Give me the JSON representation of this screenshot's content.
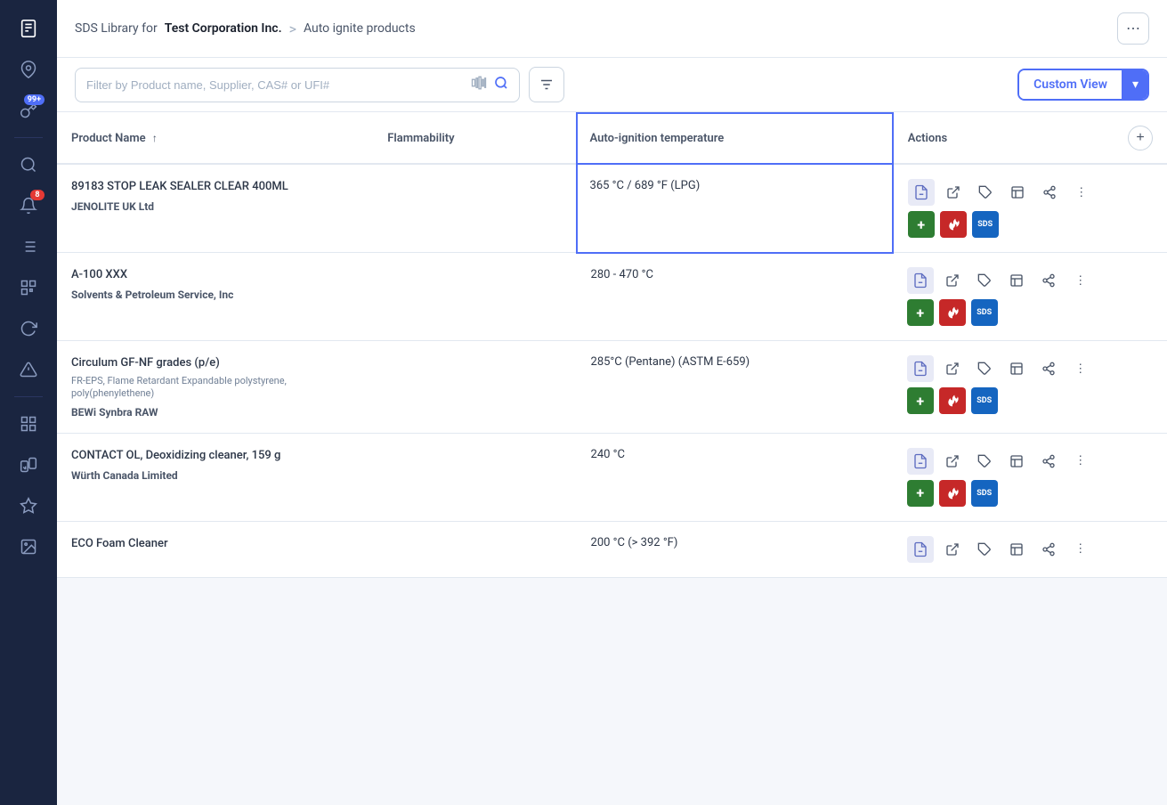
{
  "sidebar": {
    "items": [
      {
        "name": "sds-icon",
        "icon": "📄",
        "active": true,
        "badge": null
      },
      {
        "name": "location-icon",
        "icon": "📍",
        "active": false,
        "badge": null
      },
      {
        "name": "key-icon",
        "icon": "🔑",
        "active": false,
        "badge": "99+"
      },
      {
        "name": "search-globe-icon",
        "icon": "🔍",
        "active": false,
        "badge": null
      },
      {
        "name": "notification-icon",
        "icon": "🔔",
        "active": false,
        "badge": "8"
      },
      {
        "name": "list-icon",
        "icon": "📋",
        "active": false,
        "badge": null
      },
      {
        "name": "qr-icon",
        "icon": "⬛",
        "active": false,
        "badge": null
      },
      {
        "name": "refresh-icon",
        "icon": "🔄",
        "active": false,
        "badge": null
      },
      {
        "name": "alert-icon",
        "icon": "⚠",
        "active": false,
        "badge": null
      },
      {
        "name": "grid-icon",
        "icon": "⊞",
        "active": false,
        "badge": null
      },
      {
        "name": "transfer-icon",
        "icon": "⇌",
        "active": false,
        "badge": null
      },
      {
        "name": "sparkle-icon",
        "icon": "✦",
        "active": false,
        "badge": null
      },
      {
        "name": "image-icon",
        "icon": "🖼",
        "active": false,
        "badge": null
      }
    ]
  },
  "header": {
    "breadcrumb_prefix": "SDS Library for",
    "company": "Test Corporation Inc.",
    "separator": ">",
    "page": "Auto ignite products",
    "more_btn_label": "⋯"
  },
  "toolbar": {
    "search_placeholder": "Filter by Product name, Supplier, CAS# or UFI#",
    "filter_icon": "≡",
    "custom_view_label": "Custom View",
    "custom_view_arrow": "▾"
  },
  "table": {
    "columns": [
      {
        "key": "product",
        "label": "Product Name",
        "sort": "↑"
      },
      {
        "key": "flammability",
        "label": "Flammability"
      },
      {
        "key": "autoignition",
        "label": "Auto-ignition temperature",
        "highlighted": true
      },
      {
        "key": "actions",
        "label": "Actions"
      }
    ],
    "rows": [
      {
        "product_name": "89183 STOP LEAK SEALER CLEAR 400ML",
        "product_subtitle": "",
        "supplier": "JENOLITE UK Ltd",
        "flammability": "",
        "autoignition": "365 °C / 689 °F (LPG)",
        "highlighted": true
      },
      {
        "product_name": "A-100 XXX",
        "product_subtitle": "",
        "supplier": "Solvents & Petroleum Service, Inc",
        "flammability": "",
        "autoignition": "280 - 470 °C",
        "highlighted": false
      },
      {
        "product_name": "Circulum GF-NF grades (p/e)",
        "product_subtitle": "FR-EPS, Flame Retardant Expandable polystyrene, poly(phenylethene)",
        "supplier": "BEWi Synbra RAW",
        "flammability": "",
        "autoignition": "285°C (Pentane) (ASTM E-659)",
        "highlighted": false
      },
      {
        "product_name": "CONTACT OL, Deoxidizing cleaner, 159 g",
        "product_subtitle": "",
        "supplier": "Würth Canada Limited",
        "flammability": "",
        "autoignition": "240 °C",
        "highlighted": false
      },
      {
        "product_name": "ECO Foam Cleaner",
        "product_subtitle": "",
        "supplier": "",
        "flammability": "",
        "autoignition": "200 °C (> 392 °F)",
        "highlighted": false
      }
    ]
  }
}
